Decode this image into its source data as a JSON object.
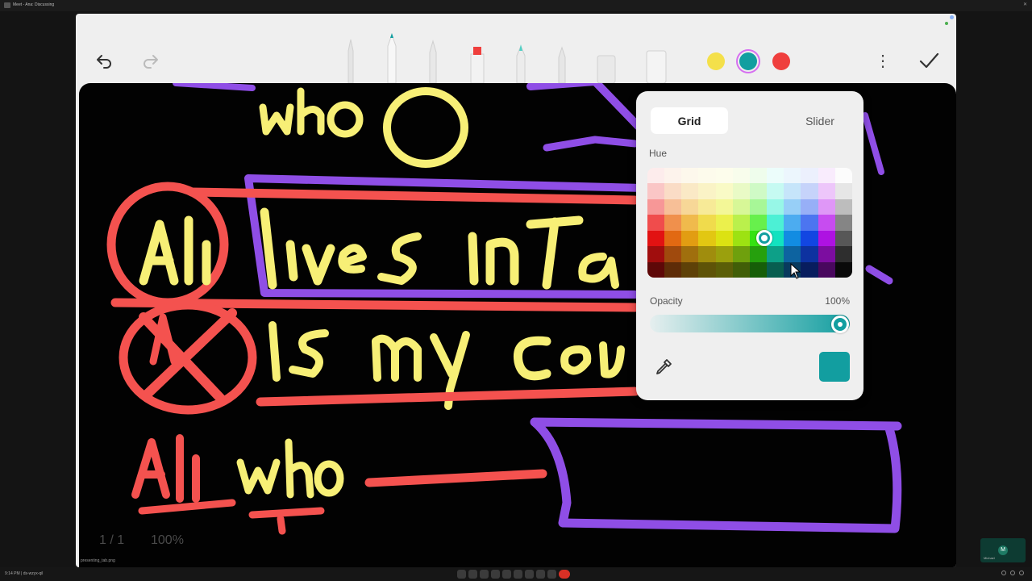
{
  "meeting_bar": {
    "title": "Meet - Ana: Discussing",
    "app_icon": "video-icon",
    "close": "✕"
  },
  "toolbar": {
    "undo_icon": "undo-icon",
    "redo_icon": "redo-icon",
    "more_icon": "more-vertical-icon",
    "more_glyph": "⋮",
    "done_icon": "check-icon",
    "tools": [
      "pen-icon",
      "fountain-pen-icon",
      "pencil-icon",
      "marker-icon",
      "highlighter-icon",
      "brush-icon",
      "eraser-icon",
      "lasso-icon"
    ],
    "swatches": [
      {
        "name": "yellow",
        "color": "#f4e04a"
      },
      {
        "name": "teal",
        "color": "#129ea0",
        "selected": true
      },
      {
        "name": "red",
        "color": "#ef3f3d"
      }
    ]
  },
  "canvas": {
    "page_indicator": "1 / 1",
    "zoom": "100%",
    "bottom_tag": "presenting_tab.png",
    "ink_colors": {
      "yellow": "#f7ef76",
      "red": "#f4524f",
      "purple": "#8f4ee6"
    }
  },
  "color_panel": {
    "tabs": [
      "Grid",
      "Slider"
    ],
    "selected_tab": "Grid",
    "hue_label": "Hue",
    "opacity_label": "Opacity",
    "opacity_value": "100%",
    "opacity_level": 1.0,
    "current_color": "#129ea0",
    "eyedropper_icon": "eyedropper-icon"
  },
  "taskbar": {
    "left_text": "9:14 PM  |  ds-wzyx-qil",
    "self_tile_initial": "M",
    "self_tile_name": "Michael"
  }
}
